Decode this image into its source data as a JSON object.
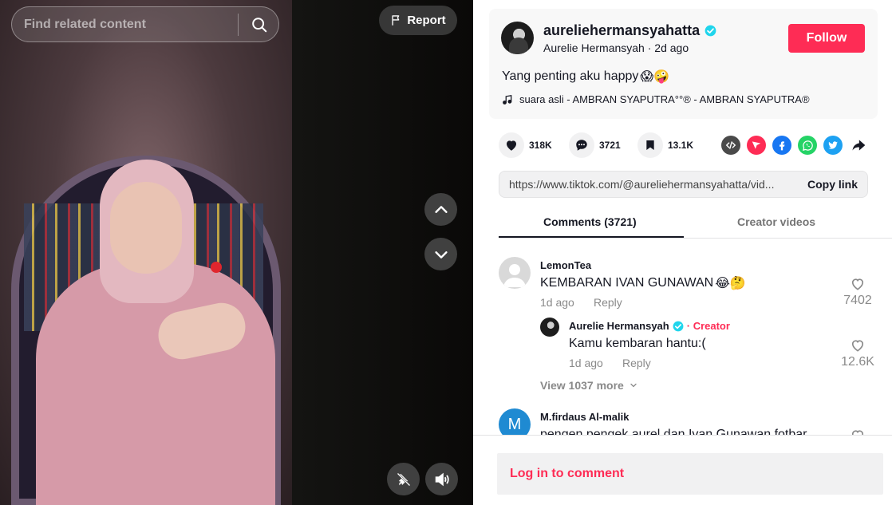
{
  "search": {
    "placeholder": "Find related content"
  },
  "video": {
    "report_label": "Report"
  },
  "author": {
    "username": "aureliehermansyahatta",
    "display_name": "Aurelie Hermansyah",
    "time": "2d ago",
    "separator": "·",
    "follow_label": "Follow",
    "caption": "Yang penting aku happy",
    "caption_emoji": "😱🤪",
    "music": "suara asli - AMBRAN SYAPUTRA°°® - AMBRAN SYAPUTRA®"
  },
  "stats": {
    "likes": "318K",
    "comments": "3721",
    "saves": "13.1K"
  },
  "share_icons": [
    "embed-icon",
    "send-icon",
    "facebook-icon",
    "whatsapp-icon",
    "twitter-icon",
    "share-arrow-icon"
  ],
  "link": {
    "url": "https://www.tiktok.com/@aureliehermansyahatta/vid...",
    "copy_label": "Copy link"
  },
  "tabs": {
    "comments": "Comments (3721)",
    "creator": "Creator videos"
  },
  "comments": [
    {
      "name": "LemonTea",
      "text": "KEMBARAN IVAN GUNAWAN",
      "emoji": "😂🤔",
      "time": "1d ago",
      "reply_label": "Reply",
      "likes": "7402",
      "replies": [
        {
          "name": "Aurelie Hermansyah",
          "badge": "Creator",
          "text": "Kamu kembaran hantu:(",
          "time": "1d ago",
          "reply_label": "Reply",
          "likes": "12.6K"
        }
      ],
      "view_more": "View 1037 more"
    },
    {
      "name": "M.firdaus Al-malik",
      "avatar_letter": "M",
      "text": "pengen pengek aurel dan Ivan Gunawan fotbar"
    }
  ],
  "login_prompt": "Log in to comment",
  "colors": {
    "accent": "#fe2c55",
    "verified": "#20d5ec",
    "avatar_m": "#1f8ad2"
  }
}
